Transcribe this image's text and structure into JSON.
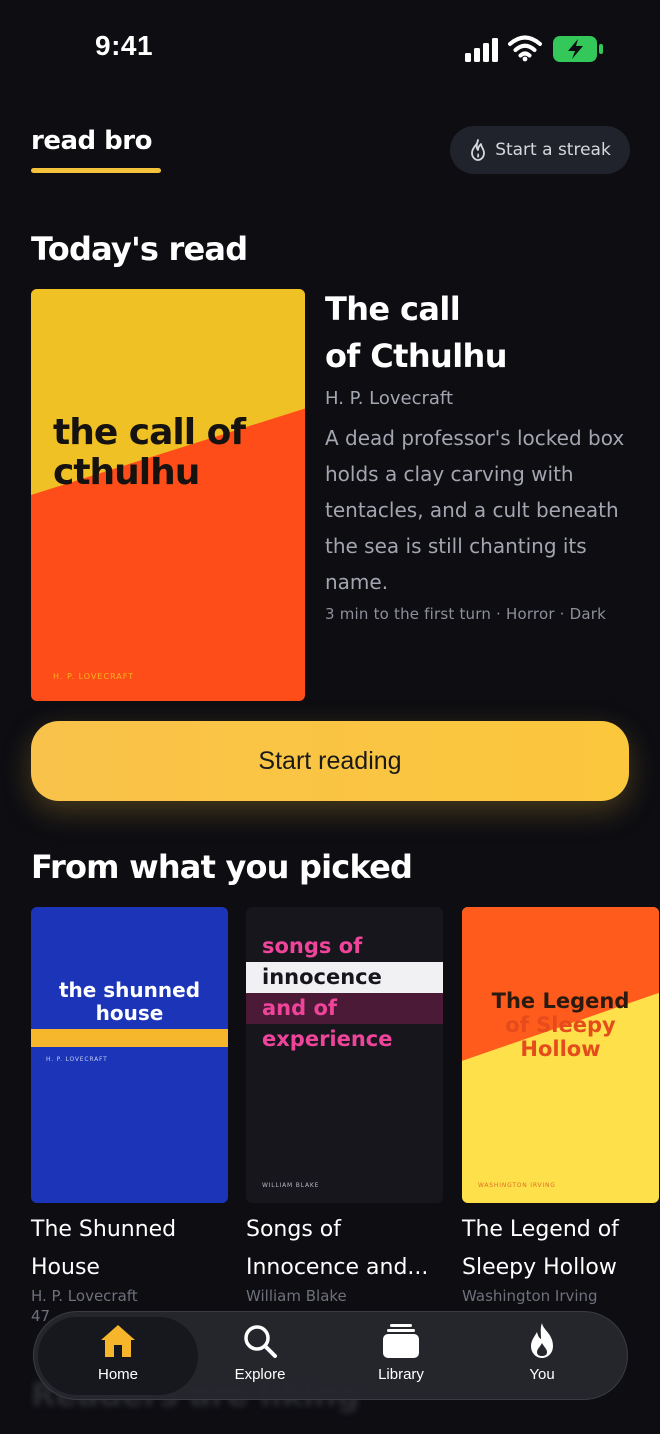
{
  "status_bar": {
    "time": "9:41"
  },
  "header": {
    "brand": "read bro",
    "streak_label": "Start a streak"
  },
  "today": {
    "section_title": "Today's read",
    "cover": {
      "title_line1": "the call of",
      "title_line2": "cthulhu",
      "author": "H. P. LOVECRAFT"
    },
    "title_line1": "The call",
    "title_line2": "of Cthulhu",
    "author": "H. P. Lovecraft",
    "description": "A dead professor's locked box holds a clay carving with tentacles, and a cult beneath the sea is still chanting its name.",
    "meta": "3 min to the first turn · Horror · Dark",
    "cta": "Start reading"
  },
  "picked": {
    "section_title": "From what you picked",
    "books": [
      {
        "cover_title_line1": "the shunned",
        "cover_title_line2": "house",
        "cover_author": "H. P. LOVECRAFT",
        "title_line1": "The Shunned",
        "title_line2": "House",
        "author": "H. P. Lovecraft",
        "extra": "47"
      },
      {
        "cover_lines": [
          "songs of",
          "innocence",
          "and of",
          "experience"
        ],
        "cover_author": "WILLIAM BLAKE",
        "title_line1": "Songs of",
        "title_line2": "Innocence and...",
        "author": "William Blake"
      },
      {
        "cover_title_line1": "The Legend",
        "cover_title_line2": "of Sleepy",
        "cover_title_line3": "Hollow",
        "cover_author": "WASHINGTON IRVING",
        "title_line1": "The Legend of",
        "title_line2": "Sleepy Hollow",
        "author": "Washington Irving"
      }
    ]
  },
  "next_section_title": "Readers are liking",
  "tabs": [
    {
      "label": "Home",
      "icon": "home-icon",
      "active": true
    },
    {
      "label": "Explore",
      "icon": "search-icon"
    },
    {
      "label": "Library",
      "icon": "library-icon"
    },
    {
      "label": "You",
      "icon": "flame-icon"
    }
  ],
  "colors": {
    "accent": "#f6c23b",
    "background": "#0d0d12",
    "hero_orange": "#ff4d1a",
    "hero_yellow": "#efc124"
  }
}
